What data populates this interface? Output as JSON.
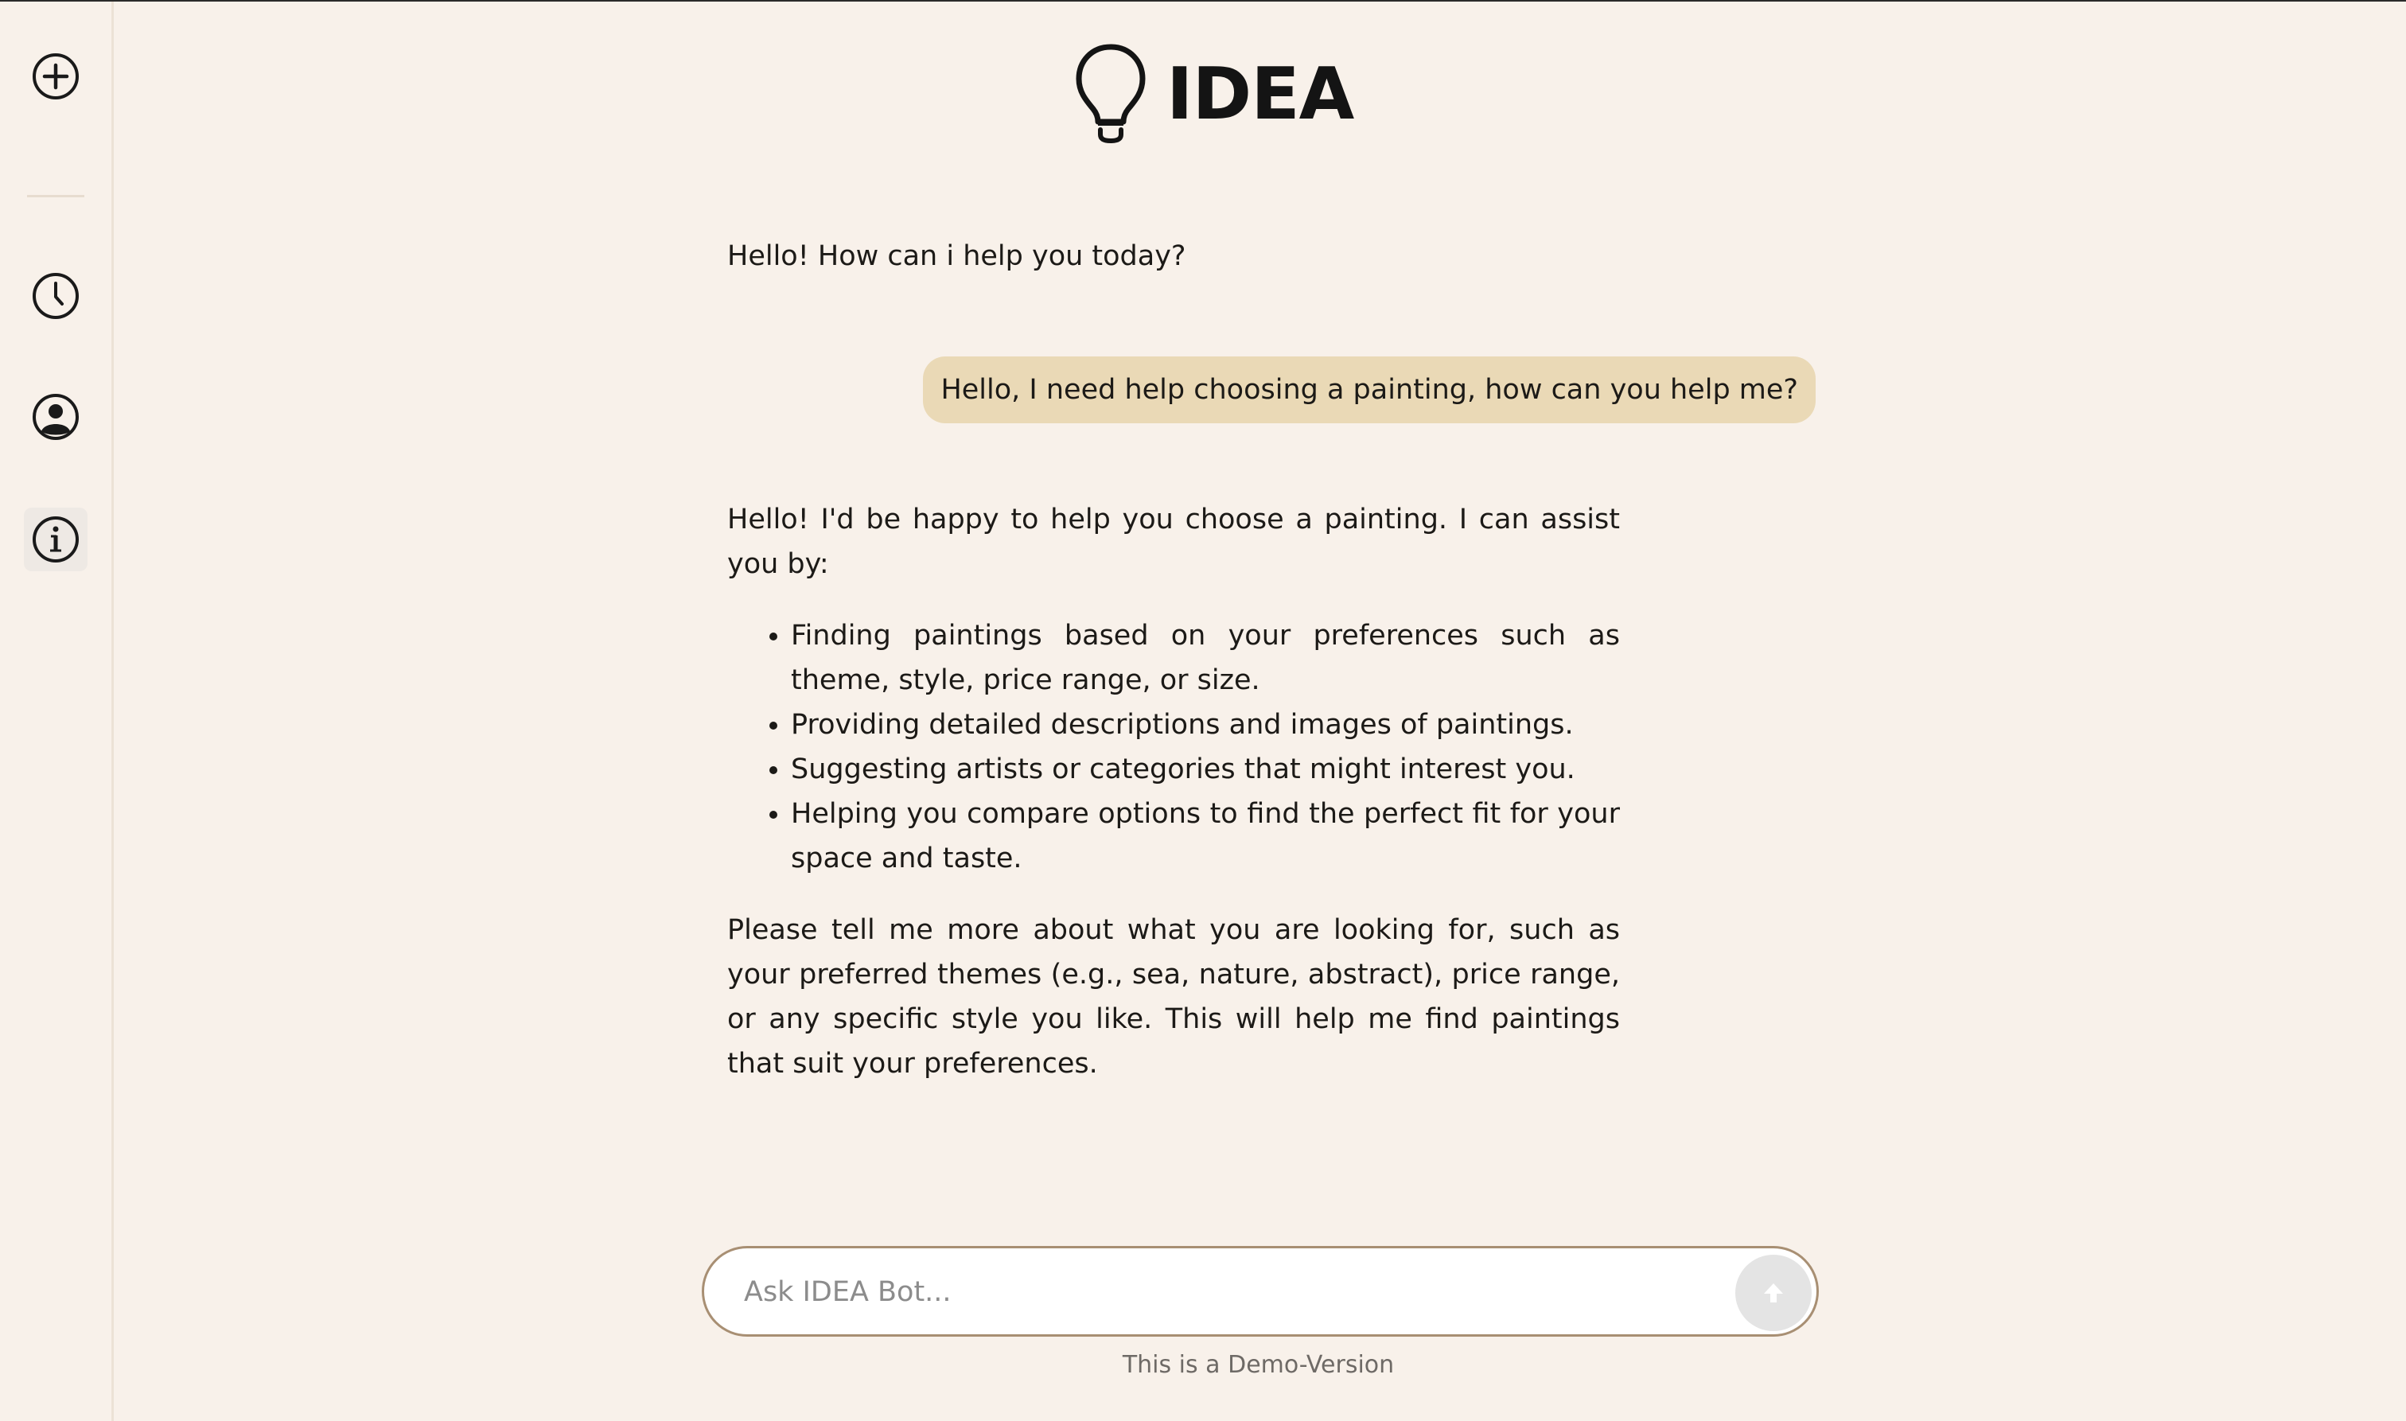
{
  "sidebar": {
    "items": [
      {
        "icon": "plus-circle-icon",
        "label": "New chat"
      },
      {
        "icon": "clock-icon",
        "label": "History"
      },
      {
        "icon": "user-circle-icon",
        "label": "Profile"
      },
      {
        "icon": "info-icon",
        "label": "Info"
      }
    ]
  },
  "header": {
    "logo_text": "IDEA",
    "logo_icon": "lightbulb-icon"
  },
  "chat": {
    "bot_greeting": "Hello! How can i help you today?",
    "user_message": "Hello, I need help choosing a painting, how can you help me?",
    "bot_reply": {
      "intro": "Hello! I'd be happy to help you choose a painting. I can assist you by:",
      "bullets": [
        "Finding paintings based on your preferences such as theme, style, price range, or size.",
        "Providing detailed descriptions and images of paintings.",
        "Suggesting artists or categories that might interest you.",
        "Helping you compare options to find the perfect fit for your space and taste."
      ],
      "outro": "Please tell me more about what you are looking for, such as your preferred themes (e.g., sea, nature, abstract), price range, or any specific style you like. This will help me find paintings that suit your preferences."
    }
  },
  "composer": {
    "placeholder": "Ask IDEA Bot...",
    "value": "",
    "send_icon": "arrow-up-icon"
  },
  "footer": {
    "note": "This is a Demo-Version"
  },
  "colors": {
    "background": "#f8f1ea",
    "user_bubble": "#ead9b6",
    "input_border": "#a88f73"
  }
}
